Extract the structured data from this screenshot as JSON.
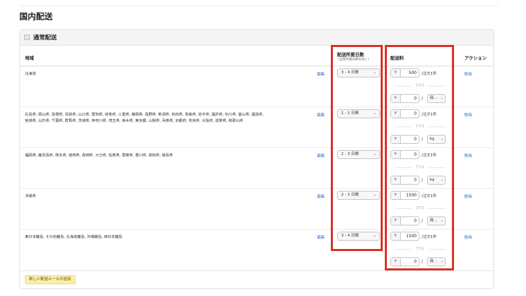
{
  "page": {
    "title": "国内配送"
  },
  "panel": {
    "title": "通常配送"
  },
  "columns": {
    "region": "地域",
    "days": "配送所要日数",
    "days_note": "(出荷作業日数を除く)",
    "fee": "配送料",
    "action": "アクション"
  },
  "labels": {
    "edit": "編集",
    "delete": "削除",
    "currency": "¥",
    "plus": "プラス",
    "slash": "/",
    "chevron": "⌄"
  },
  "rows": [
    {
      "region": "北海道",
      "days": "3 - 4 日間",
      "fee": "500",
      "fee_unit": "/注文1件",
      "add_fee": "0",
      "add_unit": "商…"
    },
    {
      "region": "広島県, 岡山県, 島根県, 鳥取県, 山口県, 愛知県, 岐阜県, 三重県, 静岡県, 長野県, 新潟県, 秋田県, 青森県, 岩手県, 福井県, 石川県, 富山県, 福島県, 宮城県, 山形県, 千葉県, 群馬県, 茨城県, 神奈川県, 埼玉県, 栃木県, 東京都, 山梨県, 兵庫県, 京都府, 奈良県, 大阪府, 滋賀県, 和歌山県",
      "days": "1 - 2 日間",
      "fee": "0",
      "fee_unit": "/注文1件",
      "add_fee": "0",
      "add_unit": "kg"
    },
    {
      "region": "福岡県, 鹿児島県, 熊本県, 宮崎県, 長崎県, 大分県, 佐賀県, 愛媛県, 香川県, 高知県, 徳島県",
      "days": "2 - 3 日間",
      "fee": "0",
      "fee_unit": "/注文1件",
      "add_fee": "0",
      "add_unit": "kg"
    },
    {
      "region": "沖縄県",
      "days": "2 - 3 日間",
      "fee": "1500",
      "fee_unit": "/注文1件",
      "add_fee": "0",
      "add_unit": "商…"
    },
    {
      "region": "東日本離島, その他離島, 北海道離島, 沖縄離島, 西日本離島",
      "days": "3 - 4 日間",
      "fee": "1500",
      "fee_unit": "/注文1件",
      "add_fee": "0",
      "add_unit": "商…"
    }
  ],
  "footer": {
    "add_rule_label": "新しい配送ルールの追加"
  },
  "colors": {
    "highlight": "#d93025",
    "link": "#2c6ecb",
    "add_button": "#fbeea7"
  }
}
